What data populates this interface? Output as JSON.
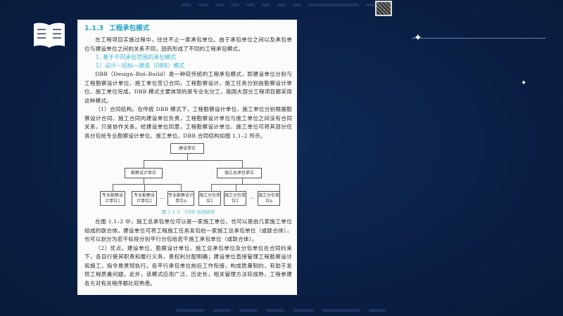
{
  "document": {
    "section_number": "1.1.3",
    "section_title": "工程承包模式",
    "intro": "在工程项目实施过程中，往往不止一家承包单位。由于承包单位之间以及承包单位与建设单位之间的关系不同，因而形成了不同的工程承包模式。",
    "subheading_1": "1. 基于不同承包范围的承包模式",
    "subheading_2": "1）设计—招标—建造（DBB）模式",
    "para_dbb": "DBB（Design–Bid–Build）是一种较传统的工程承包模式，即建设单位分别与工程勘察设计单位、施工单位签订合同，工程勘察设计、施工任务分别由勘察设计单位、施工单位完成。DBB 模式主要体现的是专业化分工，我国大部分工程项目都采用这种模式。",
    "para_contract": "（1）合同结构。在传统 DBB 模式下，工程勘察设计单位、施工单位分别根据勘察设计合同、施工合同向建设单位负责，工程勘察设计单位与施工单位之间没有合同关系，只是协作关系。经建设单位同意，工程勘察设计单位、施工单位可将其部分任务分包给专业勘察设计单位、施工单位。DBB 合同结构如图 1.1–2 所示。",
    "para_fig": "在图 1.1–2 中，施工总承包单位可以是一家施工单位，也可以是由几家施工单位组成的联合体。建设单位可将工程施工任务发包给一家施工总承包单位（或联合体），也可以划分为若干标段分别平行分包给若干施工承包单位（或联合体）。",
    "para_adv": "（2）优点。建设单位、勘察设计单位、施工总承包单位及分包单位在合同约束下，各自行使其职责和履行义务，责权利分配明确；建设单位直接管理工程勘察设计和施工，指令易贯彻执行。各平行承包单位前后工作衔接，构成质量制约，有助于发现工程质量问题。此外，该模式应用广泛、历史长，相关管理方法较成熟，工程参建各方对有关程序都比较熟悉。"
  },
  "diagram": {
    "root": "建设单位",
    "design": "勘察设计单位",
    "construction": "施工总承包单位",
    "design_subs": [
      "专业勘察设计单位1",
      "专业勘察设计单位2",
      "专业勘察设计单位n"
    ],
    "construction_subs": [
      "施工分包单位1",
      "施工分包单位2",
      "施工分包单位n"
    ],
    "ellipsis": "…",
    "caption": "图 1.1–2　DBB 合同结构"
  }
}
